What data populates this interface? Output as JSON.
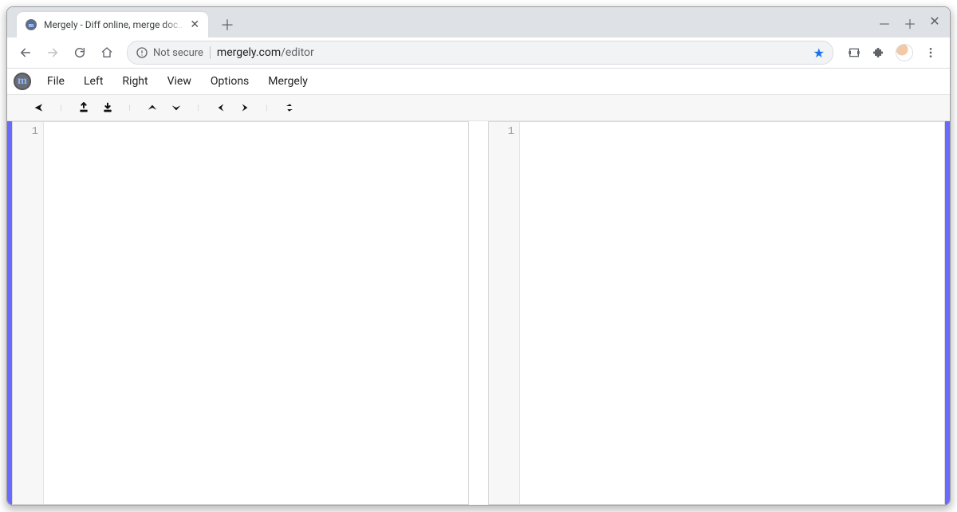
{
  "browser": {
    "tab_title": "Mergely - Diff online, merge documents",
    "security_label": "Not secure",
    "url_host": "mergely.com",
    "url_path": "/editor"
  },
  "menubar": {
    "items": [
      "File",
      "Left",
      "Right",
      "View",
      "Options",
      "Mergely"
    ]
  },
  "toolbar_icons": {
    "share": "share-icon",
    "import_left": "import-left-icon",
    "import_right": "import-right-icon",
    "prev_diff": "prev-diff-icon",
    "next_diff": "next-diff-icon",
    "merge_left": "merge-left-icon",
    "merge_right": "merge-right-icon",
    "swap": "swap-icon"
  },
  "panes": {
    "left": {
      "line_start": "1",
      "content": ""
    },
    "right": {
      "line_start": "1",
      "content": ""
    }
  }
}
